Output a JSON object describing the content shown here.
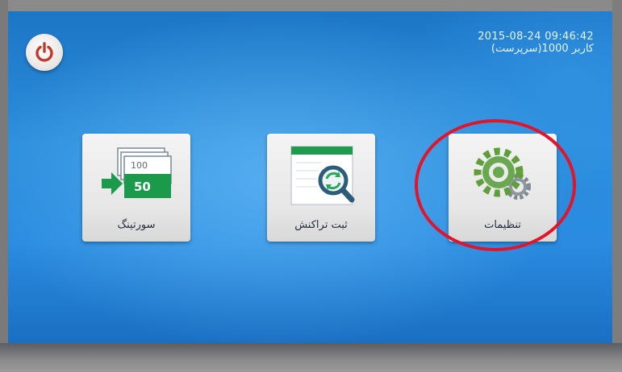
{
  "status_bar": {
    "datetime": "2015-08-24   09:46:42",
    "user_line": "کاربر  1000(سرپرست)"
  },
  "tiles": [
    {
      "label": "سورتینگ",
      "icon": "banknote-sorting-icon",
      "note_small": "100",
      "note_large": "50"
    },
    {
      "label": "ثبت تراکنش",
      "icon": "transaction-search-icon"
    },
    {
      "label": "تنظیمات",
      "icon": "settings-gears-icon"
    }
  ],
  "power_button": {
    "icon": "power-icon"
  },
  "colors": {
    "screen_blue": "#2a8be0",
    "power_red": "#c0392b",
    "gear_green": "#6aa84f",
    "highlight_red": "#e3142a"
  }
}
